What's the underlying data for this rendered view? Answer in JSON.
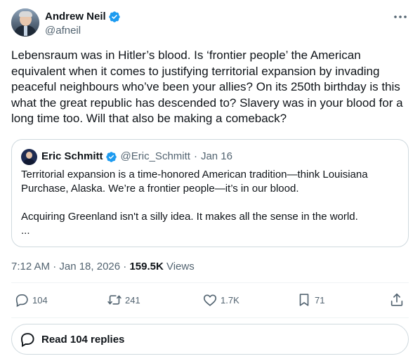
{
  "author": {
    "display_name": "Andrew Neil",
    "handle": "@afneil",
    "verified_color": "#1d9bf0"
  },
  "more_icon": "more-horizontal-icon",
  "tweet": {
    "text": "Lebensraum was in Hitler’s blood. Is ‘frontier people’ the American equivalent when it comes to justifying territorial expansion by invading peaceful neighbours who’ve been your allies? On its 250th birthday is this what the great republic has descended to? Slavery was in your blood for a long time too. Will that also be making a comeback?"
  },
  "quote": {
    "display_name": "Eric Schmitt",
    "handle": "@Eric_Schmitt",
    "separator": "·",
    "date": "Jan 16",
    "paragraph_1": "Territorial expansion is a time-honored American tradition—think Louisiana Purchase, Alaska. We’re a frontier people—it’s in our blood.",
    "paragraph_2": "Acquiring Greenland isn't a silly idea. It makes all the sense in the world.",
    "ellipsis": "..."
  },
  "meta": {
    "time_date": "7:12 AM · Jan 18, 2026 · ",
    "views_count": "159.5K",
    "views_label": " Views"
  },
  "actions": {
    "replies": "104",
    "reposts": "241",
    "likes": "1.7K",
    "bookmarks": "71"
  },
  "read_replies": {
    "label": "Read 104 replies"
  }
}
